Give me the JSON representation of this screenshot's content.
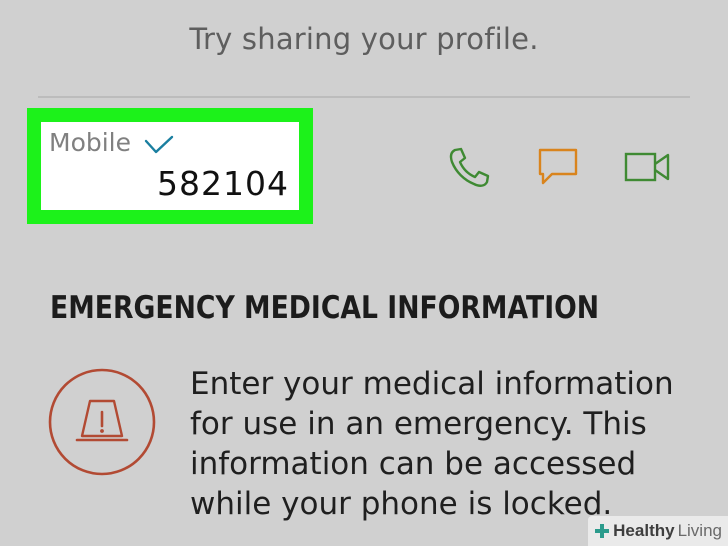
{
  "header": {
    "share_hint": "Try sharing your profile."
  },
  "contact": {
    "label": "Mobile",
    "number": "582104",
    "highlight_color": "#1cf21a",
    "actions": [
      {
        "name": "call",
        "icon": "phone-icon",
        "color": "#3f8a33"
      },
      {
        "name": "message",
        "icon": "message-icon",
        "color": "#d9841d"
      },
      {
        "name": "video",
        "icon": "video-icon",
        "color": "#3f8a33"
      }
    ]
  },
  "emergency": {
    "title": "EMERGENCY MEDICAL INFORMATION",
    "icon": "emergency-alert-icon",
    "icon_color": "#b24a33",
    "description": "Enter your medical information for use in an emergency. This information can be accessed while your phone is locked."
  },
  "watermark": {
    "brand_bold": "Healthy",
    "brand_light": "Living"
  }
}
